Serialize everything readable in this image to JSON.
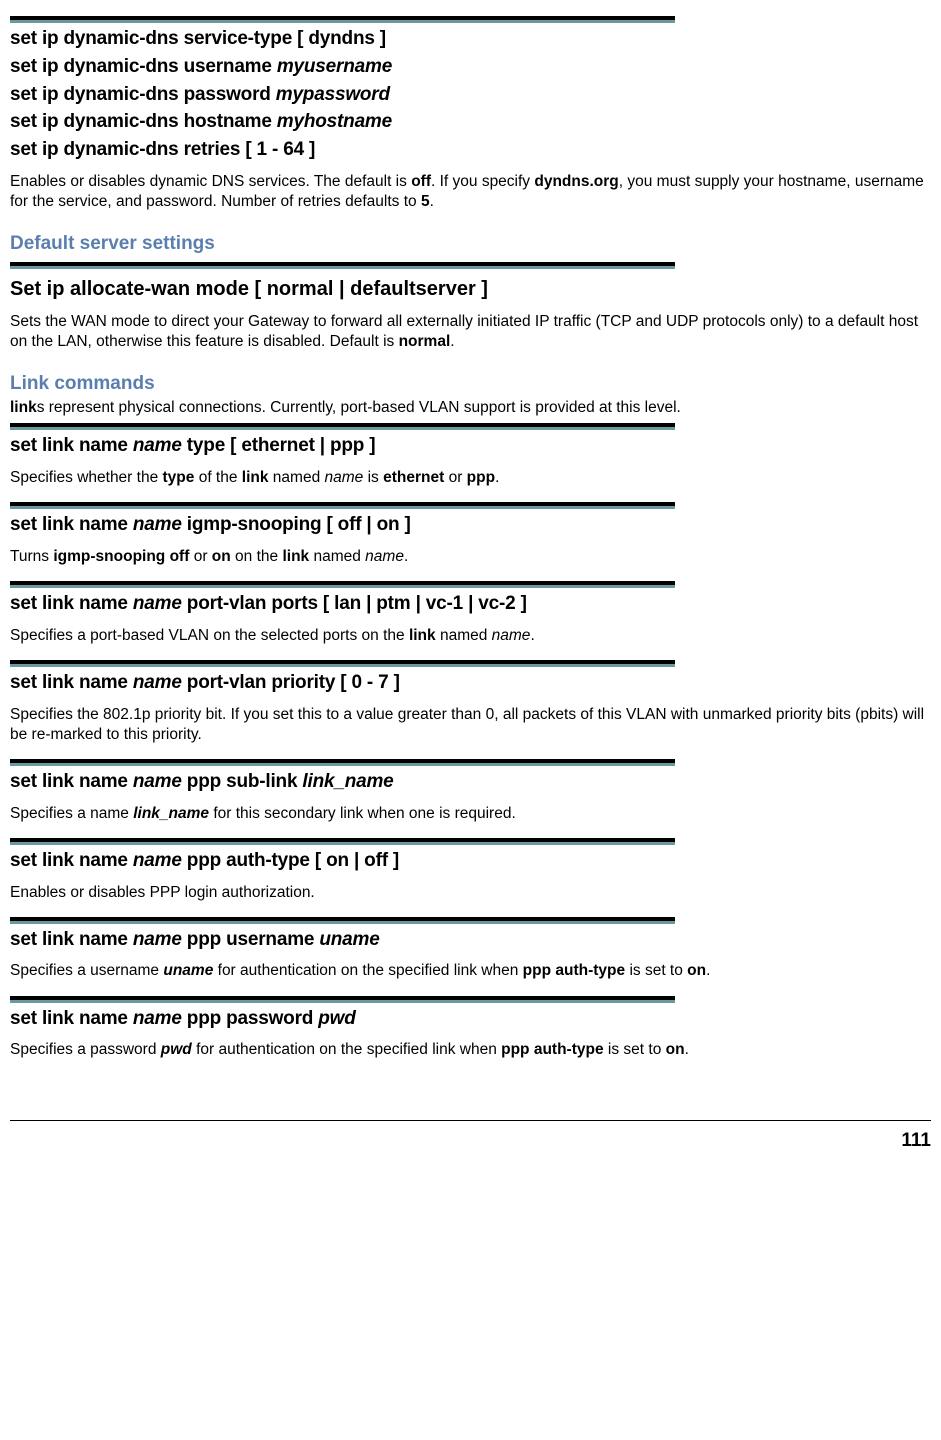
{
  "top": {
    "cmd1": "set ip dynamic-dns service-type [ dyndns ]",
    "cmd2_a": "set ip dynamic-dns username ",
    "cmd2_b": "myusername",
    "cmd3_a": "set ip dynamic-dns password ",
    "cmd3_b": "mypassword",
    "cmd4_a": "set ip dynamic-dns hostname ",
    "cmd4_b": "myhostname",
    "cmd5": "set ip dynamic-dns retries [ 1 - 64 ]",
    "desc_a": "Enables or disables dynamic DNS services. The default is ",
    "desc_b": "off",
    "desc_c": ". If you specify ",
    "desc_d": "dyndns.org",
    "desc_e": ", you must supply your hostname, username for the service, and password. Number of retries defaults to ",
    "desc_f": "5",
    "desc_g": "."
  },
  "defsrv": {
    "head": "Default server settings",
    "cmd": "Set ip allocate-wan mode [ normal | defaultserver ]",
    "desc_a": "Sets the WAN mode to direct your Gateway to forward all externally initiated IP traffic (TCP and UDP protocols only) to a default host on the LAN, otherwise this feature is disabled. Default is ",
    "desc_b": "normal",
    "desc_c": "."
  },
  "link": {
    "head": "Link commands",
    "intro_a": "link",
    "intro_b": "s represent physical connections. Currently, port-based VLAN support is provided at this level.",
    "type": {
      "c1": "set link name ",
      "c2": "name",
      "c3": " type [ ethernet | ppp ]",
      "d1": "Specifies whether the ",
      "d2": "type",
      "d3": " of the ",
      "d4": "link",
      "d5": " named ",
      "d6": "name",
      "d7": " is ",
      "d8": "ethernet",
      "d9": " or ",
      "d10": "ppp",
      "d11": "."
    },
    "igmp": {
      "c1": "set link name ",
      "c2": "name",
      "c3": " igmp-snooping [ off | on ]",
      "d1": "Turns ",
      "d2": "igmp-snooping off",
      "d3": " or ",
      "d4": "on",
      "d5": " on the ",
      "d6": "link",
      "d7": " named ",
      "d8": "name",
      "d9": "."
    },
    "ports": {
      "c1": "set link name ",
      "c2": "name",
      "c3": " port-vlan ports [ lan | ptm | vc-1 | vc-2 ]",
      "d1": "Specifies a port-based VLAN on the selected ports on the ",
      "d2": "link",
      "d3": " named ",
      "d4": "name",
      "d5": "."
    },
    "prio": {
      "c1": "set link name ",
      "c2": "name",
      "c3": " port-vlan priority [ 0 - 7 ]",
      "d1": "Specifies the 802.1p priority bit. If you set this to a value greater than 0, all packets of this VLAN with unmarked priority bits (pbits) will be re-marked to this priority."
    },
    "sublink": {
      "c1": "set link name ",
      "c2": "name",
      "c3": " ppp sub-link ",
      "c4": "link_name",
      "d1": "Specifies a name ",
      "d2": "link_name",
      "d3": " for this secondary link when one is required."
    },
    "auth": {
      "c1": "set link name ",
      "c2": "name",
      "c3": " ppp auth-type [ on | off ]",
      "d1": "Enables or disables PPP login authorization."
    },
    "user": {
      "c1": "set link name ",
      "c2": "name",
      "c3": " ppp username ",
      "c4": "uname",
      "d1": "Specifies a username ",
      "d2": "uname",
      "d3": " for authentication on the specified link when ",
      "d4": "ppp auth-type",
      "d5": " is set to ",
      "d6": "on",
      "d7": "."
    },
    "pwd": {
      "c1": "set link name ",
      "c2": "name",
      "c3": " ppp password ",
      "c4": "pwd",
      "d1": "Specifies a password ",
      "d2": "pwd",
      "d3": " for authentication on the specified link when ",
      "d4": "ppp auth-type",
      "d5": " is set to ",
      "d6": "on",
      "d7": "."
    }
  },
  "page": "111"
}
